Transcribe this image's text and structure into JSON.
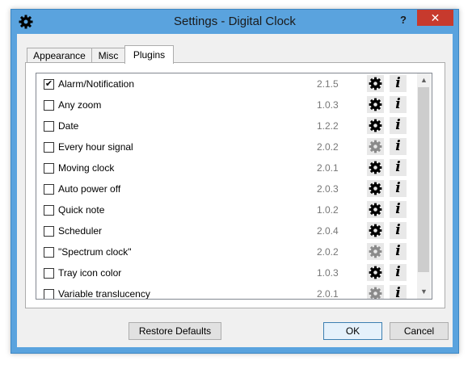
{
  "window": {
    "title": "Settings - Digital Clock",
    "help_label": "?",
    "close_label": "✕"
  },
  "tabs": [
    {
      "label": "Appearance",
      "active": false
    },
    {
      "label": "Misc",
      "active": false
    },
    {
      "label": "Plugins",
      "active": true
    }
  ],
  "plugins": [
    {
      "name": "Alarm/Notification",
      "version": "2.1.5",
      "checked": true,
      "configurable": true
    },
    {
      "name": "Any zoom",
      "version": "1.0.3",
      "checked": false,
      "configurable": true
    },
    {
      "name": "Date",
      "version": "1.2.2",
      "checked": false,
      "configurable": true
    },
    {
      "name": "Every hour signal",
      "version": "2.0.2",
      "checked": false,
      "configurable": false
    },
    {
      "name": "Moving clock",
      "version": "2.0.1",
      "checked": false,
      "configurable": true
    },
    {
      "name": "Auto power off",
      "version": "2.0.3",
      "checked": false,
      "configurable": true
    },
    {
      "name": "Quick note",
      "version": "1.0.2",
      "checked": false,
      "configurable": true
    },
    {
      "name": "Scheduler",
      "version": "2.0.4",
      "checked": false,
      "configurable": true
    },
    {
      "name": "\"Spectrum clock\"",
      "version": "2.0.2",
      "checked": false,
      "configurable": false
    },
    {
      "name": "Tray icon color",
      "version": "1.0.3",
      "checked": false,
      "configurable": true
    },
    {
      "name": "Variable translucency",
      "version": "2.0.1",
      "checked": false,
      "configurable": false
    }
  ],
  "buttons": {
    "restore_defaults": "Restore Defaults",
    "ok": "OK",
    "cancel": "Cancel"
  },
  "colors": {
    "title_bar": "#5aa3de",
    "close_button": "#c73a2d",
    "gear_enabled": "#000000",
    "gear_disabled": "#8a8a8a"
  }
}
